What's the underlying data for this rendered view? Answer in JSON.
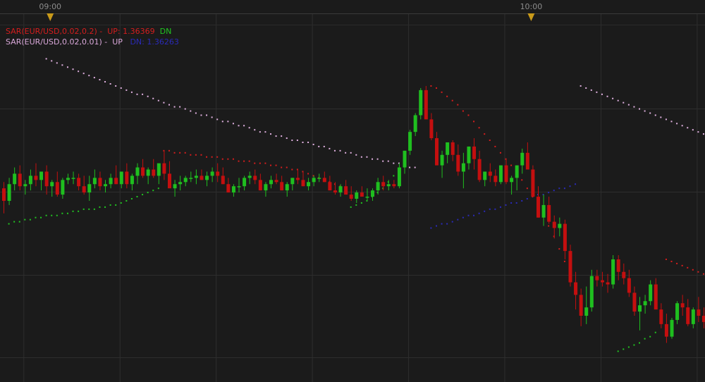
{
  "chart_data": {
    "type": "candlestick",
    "instrument": "EUR/USD",
    "time_axis": {
      "labels": [
        "09:00",
        "10:00"
      ],
      "label_candle_index": [
        9,
        99
      ]
    },
    "y_range": [
      1.3555,
      1.3722
    ],
    "legend": [
      {
        "name": "SAR(EUR/USD,0.02,0.2)",
        "up_label": "UP:",
        "up_value": "1.36369",
        "dn_label": "DN",
        "dn_value": "",
        "name_color": "#d41d1d",
        "up_color": "#d41d1d",
        "dn_color": "#21c421"
      },
      {
        "name": "SAR(EUR/USD,0.02,0.01)",
        "up_label": "UP",
        "up_value": "",
        "dn_label": "DN:",
        "dn_value": "1.36263",
        "name_color": "#d9a7d9",
        "up_color": "#d9a7d9",
        "dn_color": "#2a2ab8"
      }
    ],
    "colors": {
      "bull": "#1fbf1f",
      "bear": "#c40f0f",
      "sar1_up": "#d41d1d",
      "sar1_dn": "#21c421",
      "sar2_up": "#e0b0e0",
      "sar2_dn": "#2a2ab8",
      "marker": "#c99a1a",
      "grid": "#2e2e2e",
      "background": "#1b1b1b"
    },
    "candles": [
      [
        1.3644,
        1.3647,
        1.3632,
        1.3638
      ],
      [
        1.3638,
        1.3649,
        1.3636,
        1.3646
      ],
      [
        1.3646,
        1.3654,
        1.3643,
        1.3651
      ],
      [
        1.3651,
        1.3655,
        1.3643,
        1.3645
      ],
      [
        1.3645,
        1.3648,
        1.3641,
        1.3646
      ],
      [
        1.3646,
        1.3653,
        1.3643,
        1.365
      ],
      [
        1.365,
        1.3656,
        1.3645,
        1.3648
      ],
      [
        1.3648,
        1.3652,
        1.3643,
        1.3652
      ],
      [
        1.3652,
        1.3655,
        1.3641,
        1.3645
      ],
      [
        1.3645,
        1.3648,
        1.364,
        1.3647
      ],
      [
        1.3647,
        1.3652,
        1.364,
        1.3641
      ],
      [
        1.3641,
        1.3649,
        1.3639,
        1.3648
      ],
      [
        1.3648,
        1.3651,
        1.3646,
        1.3649
      ],
      [
        1.3649,
        1.3652,
        1.3646,
        1.3649
      ],
      [
        1.3649,
        1.3651,
        1.3643,
        1.3645
      ],
      [
        1.3645,
        1.365,
        1.3641,
        1.3642
      ],
      [
        1.3642,
        1.365,
        1.3638,
        1.3646
      ],
      [
        1.3646,
        1.3653,
        1.3644,
        1.3649
      ],
      [
        1.3649,
        1.3652,
        1.3643,
        1.3645
      ],
      [
        1.3645,
        1.3648,
        1.3642,
        1.3646
      ],
      [
        1.3646,
        1.3651,
        1.3644,
        1.3649
      ],
      [
        1.3649,
        1.3655,
        1.3646,
        1.3646
      ],
      [
        1.3646,
        1.3652,
        1.3644,
        1.3652
      ],
      [
        1.3652,
        1.3656,
        1.3644,
        1.3646
      ],
      [
        1.3646,
        1.3651,
        1.3643,
        1.365
      ],
      [
        1.365,
        1.3656,
        1.3646,
        1.3654
      ],
      [
        1.3654,
        1.3658,
        1.3649,
        1.365
      ],
      [
        1.365,
        1.3654,
        1.3646,
        1.3653
      ],
      [
        1.3653,
        1.3658,
        1.3649,
        1.365
      ],
      [
        1.365,
        1.3654,
        1.3646,
        1.3656
      ],
      [
        1.3656,
        1.3662,
        1.3648,
        1.3651
      ],
      [
        1.3651,
        1.3657,
        1.3645,
        1.3644
      ],
      [
        1.3644,
        1.3648,
        1.364,
        1.3646
      ],
      [
        1.3646,
        1.365,
        1.3643,
        1.3647
      ],
      [
        1.3647,
        1.365,
        1.3645,
        1.3649
      ],
      [
        1.3649,
        1.3652,
        1.3647,
        1.3649
      ],
      [
        1.3649,
        1.3653,
        1.3646,
        1.365
      ],
      [
        1.365,
        1.3653,
        1.3648,
        1.3648
      ],
      [
        1.3648,
        1.3652,
        1.3645,
        1.365
      ],
      [
        1.365,
        1.3654,
        1.3647,
        1.3652
      ],
      [
        1.3652,
        1.3656,
        1.3647,
        1.365
      ],
      [
        1.365,
        1.3654,
        1.3646,
        1.3646
      ],
      [
        1.3646,
        1.3649,
        1.3642,
        1.3642
      ],
      [
        1.3642,
        1.3646,
        1.364,
        1.3645
      ],
      [
        1.3645,
        1.3649,
        1.3642,
        1.3645
      ],
      [
        1.3645,
        1.365,
        1.3643,
        1.3649
      ],
      [
        1.3649,
        1.3652,
        1.3646,
        1.365
      ],
      [
        1.365,
        1.3653,
        1.3646,
        1.3648
      ],
      [
        1.3648,
        1.3651,
        1.3643,
        1.3643
      ],
      [
        1.3643,
        1.3647,
        1.364,
        1.3646
      ],
      [
        1.3646,
        1.365,
        1.3644,
        1.3648
      ],
      [
        1.3648,
        1.3651,
        1.3646,
        1.3647
      ],
      [
        1.3647,
        1.365,
        1.3643,
        1.3643
      ],
      [
        1.3643,
        1.3647,
        1.364,
        1.3646
      ],
      [
        1.3646,
        1.3649,
        1.3643,
        1.3649
      ],
      [
        1.3649,
        1.3653,
        1.3646,
        1.3648
      ],
      [
        1.3648,
        1.3652,
        1.3645,
        1.3645
      ],
      [
        1.3645,
        1.3649,
        1.3643,
        1.3647
      ],
      [
        1.3647,
        1.365,
        1.3645,
        1.3649
      ],
      [
        1.3649,
        1.3651,
        1.3647,
        1.3649
      ],
      [
        1.3649,
        1.3652,
        1.3647,
        1.3647
      ],
      [
        1.3647,
        1.365,
        1.3643,
        1.3643
      ],
      [
        1.3643,
        1.3647,
        1.3641,
        1.3642
      ],
      [
        1.3642,
        1.3646,
        1.364,
        1.3645
      ],
      [
        1.3645,
        1.3648,
        1.3641,
        1.3641
      ],
      [
        1.3641,
        1.3645,
        1.3638,
        1.3639
      ],
      [
        1.3639,
        1.3643,
        1.3637,
        1.3642
      ],
      [
        1.3642,
        1.3645,
        1.364,
        1.364
      ],
      [
        1.364,
        1.3644,
        1.3638,
        1.364
      ],
      [
        1.364,
        1.3644,
        1.3638,
        1.3643
      ],
      [
        1.3643,
        1.3649,
        1.3641,
        1.3647
      ],
      [
        1.3647,
        1.365,
        1.3643,
        1.3645
      ],
      [
        1.3645,
        1.3648,
        1.3643,
        1.3646
      ],
      [
        1.3646,
        1.3648,
        1.3644,
        1.3645
      ],
      [
        1.3645,
        1.3656,
        1.3644,
        1.3654
      ],
      [
        1.3654,
        1.3662,
        1.3651,
        1.3662
      ],
      [
        1.3662,
        1.3672,
        1.366,
        1.3671
      ],
      [
        1.3671,
        1.368,
        1.3669,
        1.3679
      ],
      [
        1.3679,
        1.3692,
        1.3677,
        1.3691
      ],
      [
        1.3691,
        1.3693,
        1.3677,
        1.3677
      ],
      [
        1.3677,
        1.368,
        1.3667,
        1.3668
      ],
      [
        1.3668,
        1.3671,
        1.3655,
        1.3655
      ],
      [
        1.3655,
        1.3662,
        1.3649,
        1.366
      ],
      [
        1.366,
        1.3666,
        1.3656,
        1.3666
      ],
      [
        1.3666,
        1.3667,
        1.3657,
        1.366
      ],
      [
        1.366,
        1.3665,
        1.365,
        1.3652
      ],
      [
        1.3652,
        1.3661,
        1.3644,
        1.3656
      ],
      [
        1.3656,
        1.3664,
        1.3653,
        1.3664
      ],
      [
        1.3664,
        1.3668,
        1.3653,
        1.3658
      ],
      [
        1.3658,
        1.3662,
        1.3647,
        1.3648
      ],
      [
        1.3648,
        1.3652,
        1.3645,
        1.3652
      ],
      [
        1.3652,
        1.3656,
        1.3647,
        1.365
      ],
      [
        1.365,
        1.3653,
        1.3645,
        1.3647
      ],
      [
        1.3647,
        1.3655,
        1.3646,
        1.3655
      ],
      [
        1.3655,
        1.3658,
        1.3646,
        1.3647
      ],
      [
        1.3647,
        1.365,
        1.3641,
        1.3649
      ],
      [
        1.3649,
        1.3655,
        1.3643,
        1.3655
      ],
      [
        1.3655,
        1.3663,
        1.3651,
        1.3661
      ],
      [
        1.3661,
        1.3666,
        1.3653,
        1.3653
      ],
      [
        1.3653,
        1.3655,
        1.364,
        1.364
      ],
      [
        1.364,
        1.3645,
        1.363,
        1.363
      ],
      [
        1.363,
        1.3641,
        1.3626,
        1.3636
      ],
      [
        1.3636,
        1.364,
        1.3627,
        1.3628
      ],
      [
        1.3628,
        1.3631,
        1.362,
        1.3625
      ],
      [
        1.3625,
        1.363,
        1.3621,
        1.3627
      ],
      [
        1.3627,
        1.3629,
        1.361,
        1.3614
      ],
      [
        1.3614,
        1.3617,
        1.3597,
        1.3599
      ],
      [
        1.3599,
        1.3604,
        1.3586,
        1.3593
      ],
      [
        1.3593,
        1.3596,
        1.3578,
        1.3583
      ],
      [
        1.3583,
        1.3597,
        1.3579,
        1.3587
      ],
      [
        1.3587,
        1.3605,
        1.3585,
        1.3602
      ],
      [
        1.3602,
        1.3605,
        1.3597,
        1.36
      ],
      [
        1.36,
        1.3604,
        1.3597,
        1.3599
      ],
      [
        1.3599,
        1.3603,
        1.3594,
        1.3598
      ],
      [
        1.3598,
        1.3612,
        1.3596,
        1.361
      ],
      [
        1.361,
        1.3612,
        1.36,
        1.3604
      ],
      [
        1.3604,
        1.3608,
        1.3598,
        1.3601
      ],
      [
        1.3601,
        1.3605,
        1.3592,
        1.3594
      ],
      [
        1.3594,
        1.3597,
        1.3583,
        1.3585
      ],
      [
        1.3585,
        1.3592,
        1.3576,
        1.3588
      ],
      [
        1.3588,
        1.3593,
        1.3584,
        1.359
      ],
      [
        1.359,
        1.36,
        1.3588,
        1.3598
      ],
      [
        1.3598,
        1.3601,
        1.3586,
        1.3586
      ],
      [
        1.3586,
        1.3589,
        1.3577,
        1.3579
      ],
      [
        1.3579,
        1.3584,
        1.357,
        1.3573
      ],
      [
        1.3573,
        1.3582,
        1.3572,
        1.3581
      ],
      [
        1.3581,
        1.359,
        1.3579,
        1.3589
      ],
      [
        1.3589,
        1.3593,
        1.3583,
        1.3587
      ],
      [
        1.3587,
        1.3591,
        1.3578,
        1.3579
      ],
      [
        1.3579,
        1.3587,
        1.3577,
        1.3586
      ],
      [
        1.3586,
        1.3592,
        1.358,
        1.3583
      ],
      [
        1.3583,
        1.3587,
        1.3577,
        1.358
      ],
      [
        1.358,
        1.3585,
        1.3574,
        1.3576
      ]
    ],
    "sar1_segments": [
      {
        "dir": "dn",
        "start": 1,
        "values": [
          1.3627,
          1.3628,
          1.3628,
          1.3629,
          1.3629,
          1.363,
          1.363,
          1.3631,
          1.3631,
          1.3631,
          1.3632,
          1.3632,
          1.3633,
          1.3633,
          1.3634,
          1.3634,
          1.3634,
          1.3635,
          1.3635,
          1.3636,
          1.3636,
          1.3637,
          1.3638,
          1.3639,
          1.364,
          1.3641,
          1.3642,
          1.3643,
          1.3644
        ]
      },
      {
        "dir": "up",
        "start": 30,
        "values": [
          1.3662,
          1.3662,
          1.3661,
          1.3661,
          1.3661,
          1.366,
          1.366,
          1.366,
          1.3659,
          1.3659,
          1.3659,
          1.3658,
          1.3658,
          1.3658,
          1.3657,
          1.3657,
          1.3657,
          1.3656,
          1.3656,
          1.3656,
          1.3655,
          1.3655,
          1.3654,
          1.3654,
          1.3653,
          1.3653,
          1.3652,
          1.3651,
          1.365,
          1.3649,
          1.3648,
          1.3647,
          1.3646,
          1.3645,
          1.3644
        ]
      },
      {
        "dir": "dn",
        "start": 65,
        "values": [
          1.3635,
          1.3636,
          1.3637,
          1.3638,
          1.364,
          1.3642,
          1.3644,
          1.3647,
          1.365
        ]
      },
      {
        "dir": "up",
        "start": 80,
        "values": [
          1.3693,
          1.3692,
          1.369,
          1.3688,
          1.3686,
          1.3684,
          1.3681,
          1.3679,
          1.3676,
          1.3673,
          1.367,
          1.3667,
          1.3664,
          1.3661,
          1.3658,
          1.3655,
          1.3652,
          1.3648,
          1.3644,
          1.364,
          1.3636,
          1.3631,
          1.3626,
          1.3621,
          1.3615,
          1.3609
        ]
      },
      {
        "dir": "dn",
        "start": 115,
        "values": [
          1.3566,
          1.3567,
          1.3568,
          1.3569,
          1.357,
          1.3572,
          1.3573,
          1.3575
        ]
      },
      {
        "dir": "up",
        "start": 124,
        "values": [
          1.361,
          1.3609,
          1.3608,
          1.3607,
          1.3606,
          1.3605,
          1.3604,
          1.3603,
          1.3602,
          1.3601,
          1.36,
          1.3599,
          1.3598,
          1.3597,
          1.3596,
          1.3595,
          1.3594
        ]
      }
    ],
    "sar2_segments": [
      {
        "dir": "up",
        "start": 8,
        "values": [
          1.3706,
          1.3705,
          1.3704,
          1.3703,
          1.3702,
          1.3701,
          1.37,
          1.3699,
          1.3698,
          1.3697,
          1.3696,
          1.3695,
          1.3694,
          1.3693,
          1.3692,
          1.3691,
          1.369,
          1.3689,
          1.3689,
          1.3688,
          1.3687,
          1.3686,
          1.3685,
          1.3684,
          1.3683,
          1.3683,
          1.3682,
          1.3681,
          1.368,
          1.3679,
          1.3679,
          1.3678,
          1.3677,
          1.3676,
          1.3676,
          1.3675,
          1.3674,
          1.3674,
          1.3673,
          1.3672,
          1.3671,
          1.3671,
          1.367,
          1.3669,
          1.3669,
          1.3668,
          1.3667,
          1.3667,
          1.3666,
          1.3666,
          1.3665,
          1.3664,
          1.3664,
          1.3663,
          1.3662,
          1.3662,
          1.3661,
          1.3661,
          1.366,
          1.3659,
          1.3659,
          1.3658,
          1.3658,
          1.3657,
          1.3657,
          1.3656,
          1.3656,
          1.3655,
          1.3654,
          1.3654
        ]
      },
      {
        "dir": "dn",
        "start": 80,
        "values": [
          1.3625,
          1.3626,
          1.3627,
          1.3627,
          1.3628,
          1.3629,
          1.363,
          1.3631,
          1.3631,
          1.3632,
          1.3633,
          1.3634,
          1.3634,
          1.3635,
          1.3636,
          1.3637,
          1.3637,
          1.3638,
          1.3639,
          1.364,
          1.3641,
          1.3641,
          1.3642,
          1.3643,
          1.3644,
          1.3644,
          1.3645,
          1.3646
        ]
      },
      {
        "dir": "up",
        "start": 108,
        "values": [
          1.3693,
          1.3692,
          1.3691,
          1.369,
          1.3689,
          1.3688,
          1.3687,
          1.3686,
          1.3685,
          1.3684,
          1.3683,
          1.3682,
          1.3681,
          1.368,
          1.3679,
          1.3678,
          1.3677,
          1.3676,
          1.3675,
          1.3674,
          1.3673,
          1.3672,
          1.3671,
          1.367,
          1.3669,
          1.3668,
          1.3667,
          1.3666,
          1.3665,
          1.3664,
          1.3663,
          1.3662,
          1.3661
        ]
      }
    ]
  }
}
